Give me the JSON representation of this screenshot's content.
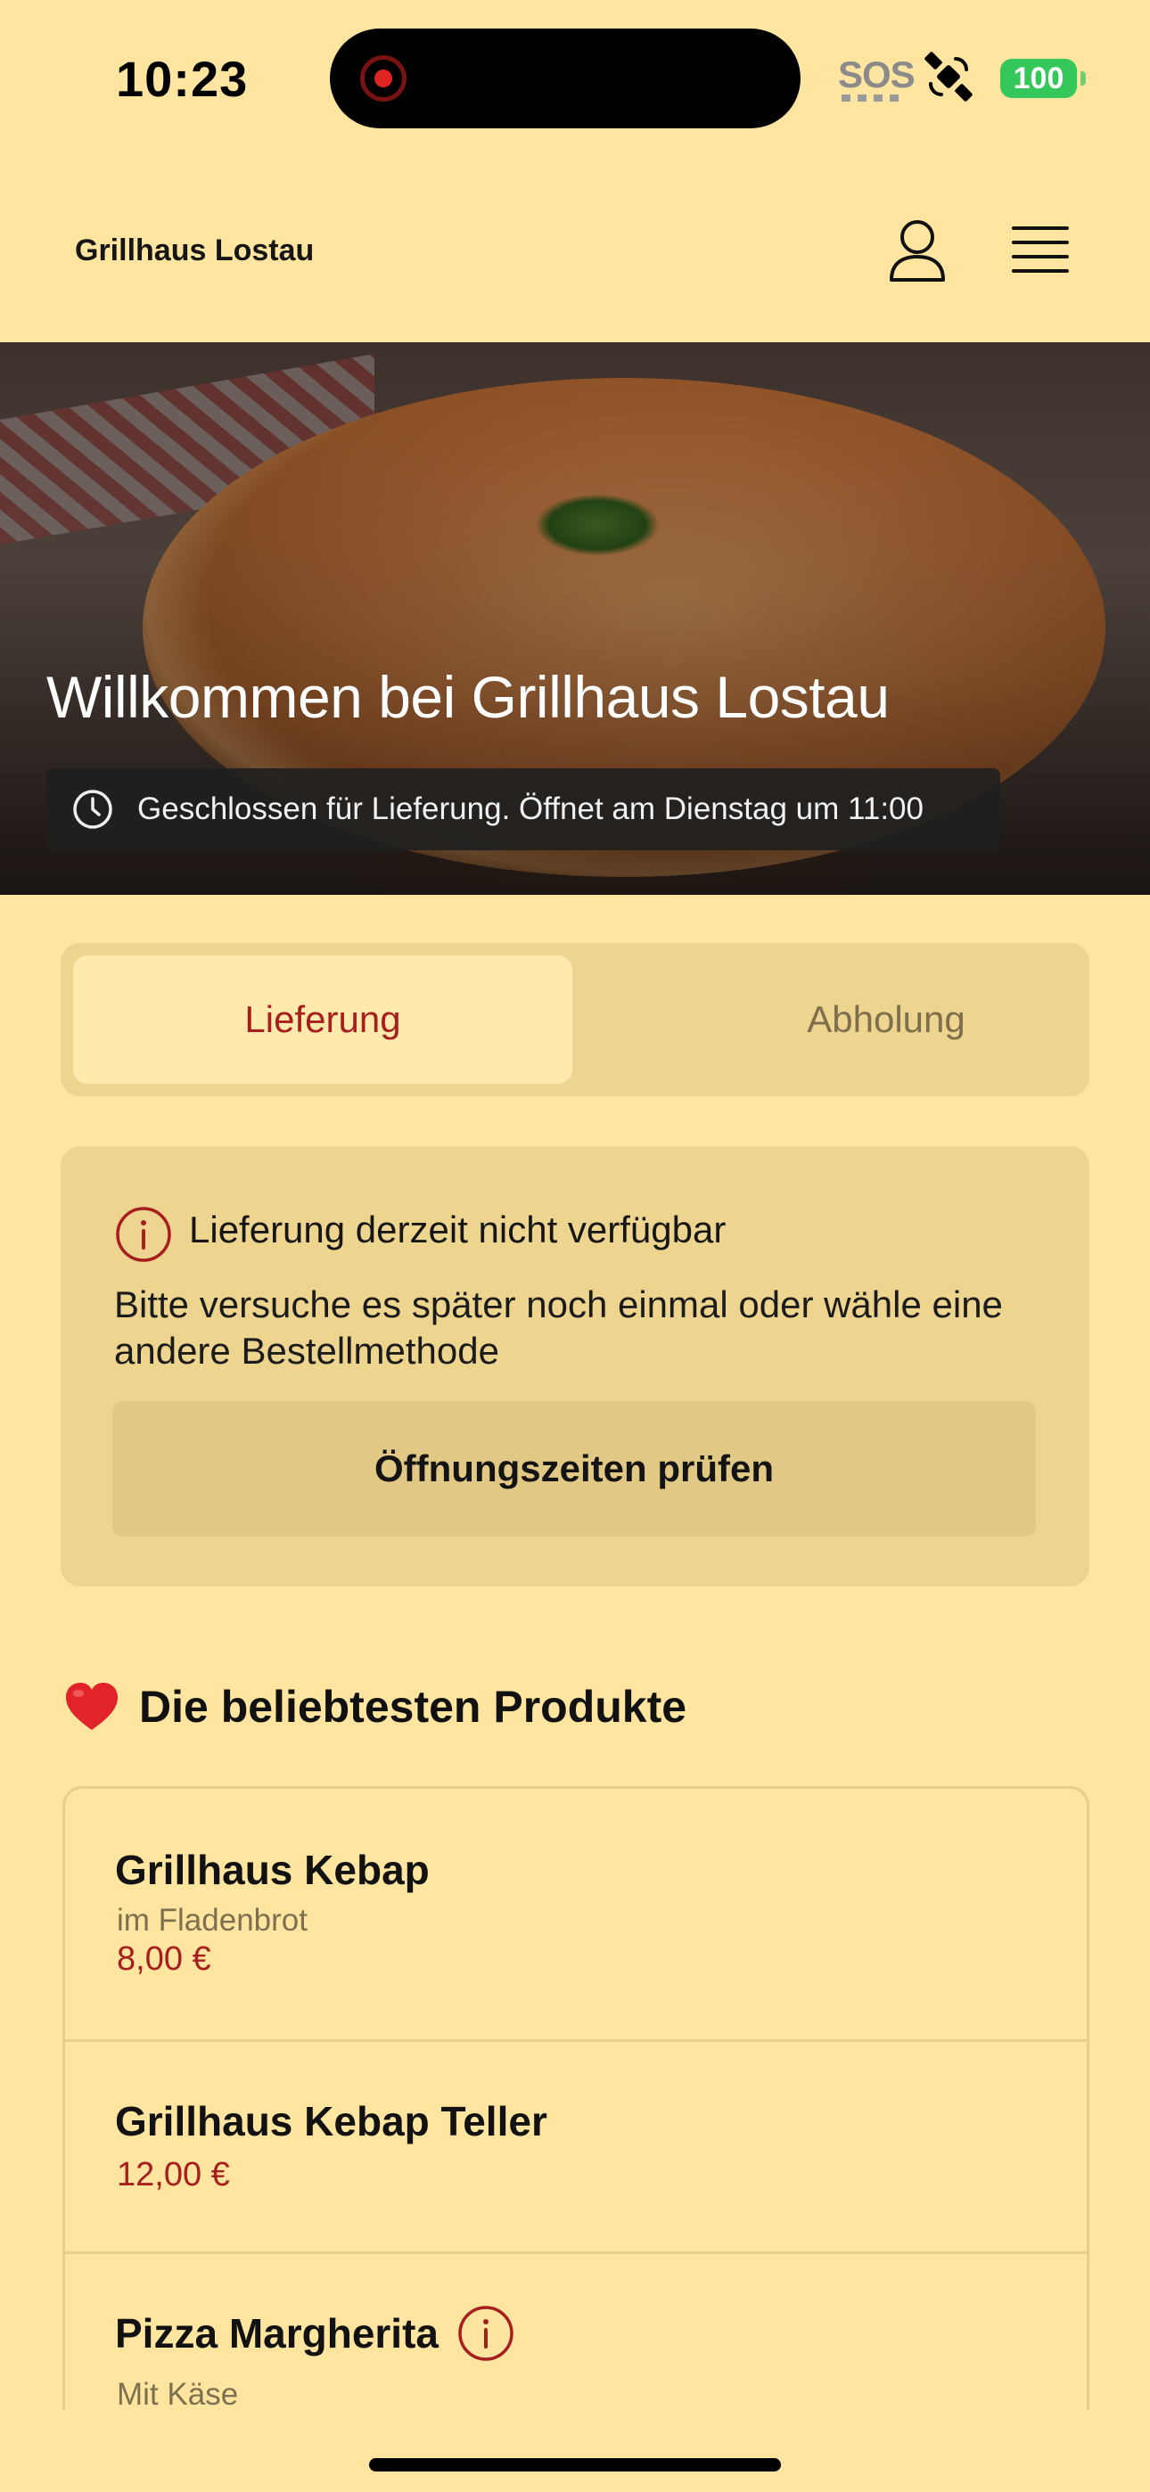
{
  "status_bar": {
    "time": "10:23",
    "sos": "SOS",
    "battery": "100",
    "battery_color": "#34c759"
  },
  "header": {
    "brand": "Grillhaus Lostau",
    "account_icon": "user-icon",
    "menu_icon": "hamburger-menu-icon"
  },
  "hero": {
    "title": "Willkommen bei Grillhaus Lostau",
    "status": "Geschlossen für Lieferung. Öffnet am Dienstag um 11:00",
    "status_icon": "clock-icon"
  },
  "order_type": {
    "options": [
      {
        "label": "Lieferung",
        "selected": true
      },
      {
        "label": "Abholung",
        "selected": false
      }
    ],
    "accent_color": "#a61e1e"
  },
  "notice": {
    "icon": "info-circle-icon",
    "title": "Lieferung derzeit nicht verfügbar",
    "text": "Bitte versuche es später noch einmal oder wähle eine andere Bestellmethode",
    "button": "Öffnungszeiten prüfen"
  },
  "popular": {
    "icon": "heart-icon",
    "title": "Die beliebtesten Produkte",
    "products": [
      {
        "name": "Grillhaus Kebap",
        "description": "im Fladenbrot",
        "price": "8,00 €"
      },
      {
        "name": "Grillhaus Kebap Teller",
        "description": "",
        "price": "12,00 €"
      },
      {
        "name": "Pizza Margherita",
        "description": "Mit Käse",
        "price": "",
        "info_icon": "info-circle-icon"
      }
    ]
  },
  "colors": {
    "background": "#FFE59F",
    "card": "#EDD48F",
    "price": "#a61e1e"
  }
}
